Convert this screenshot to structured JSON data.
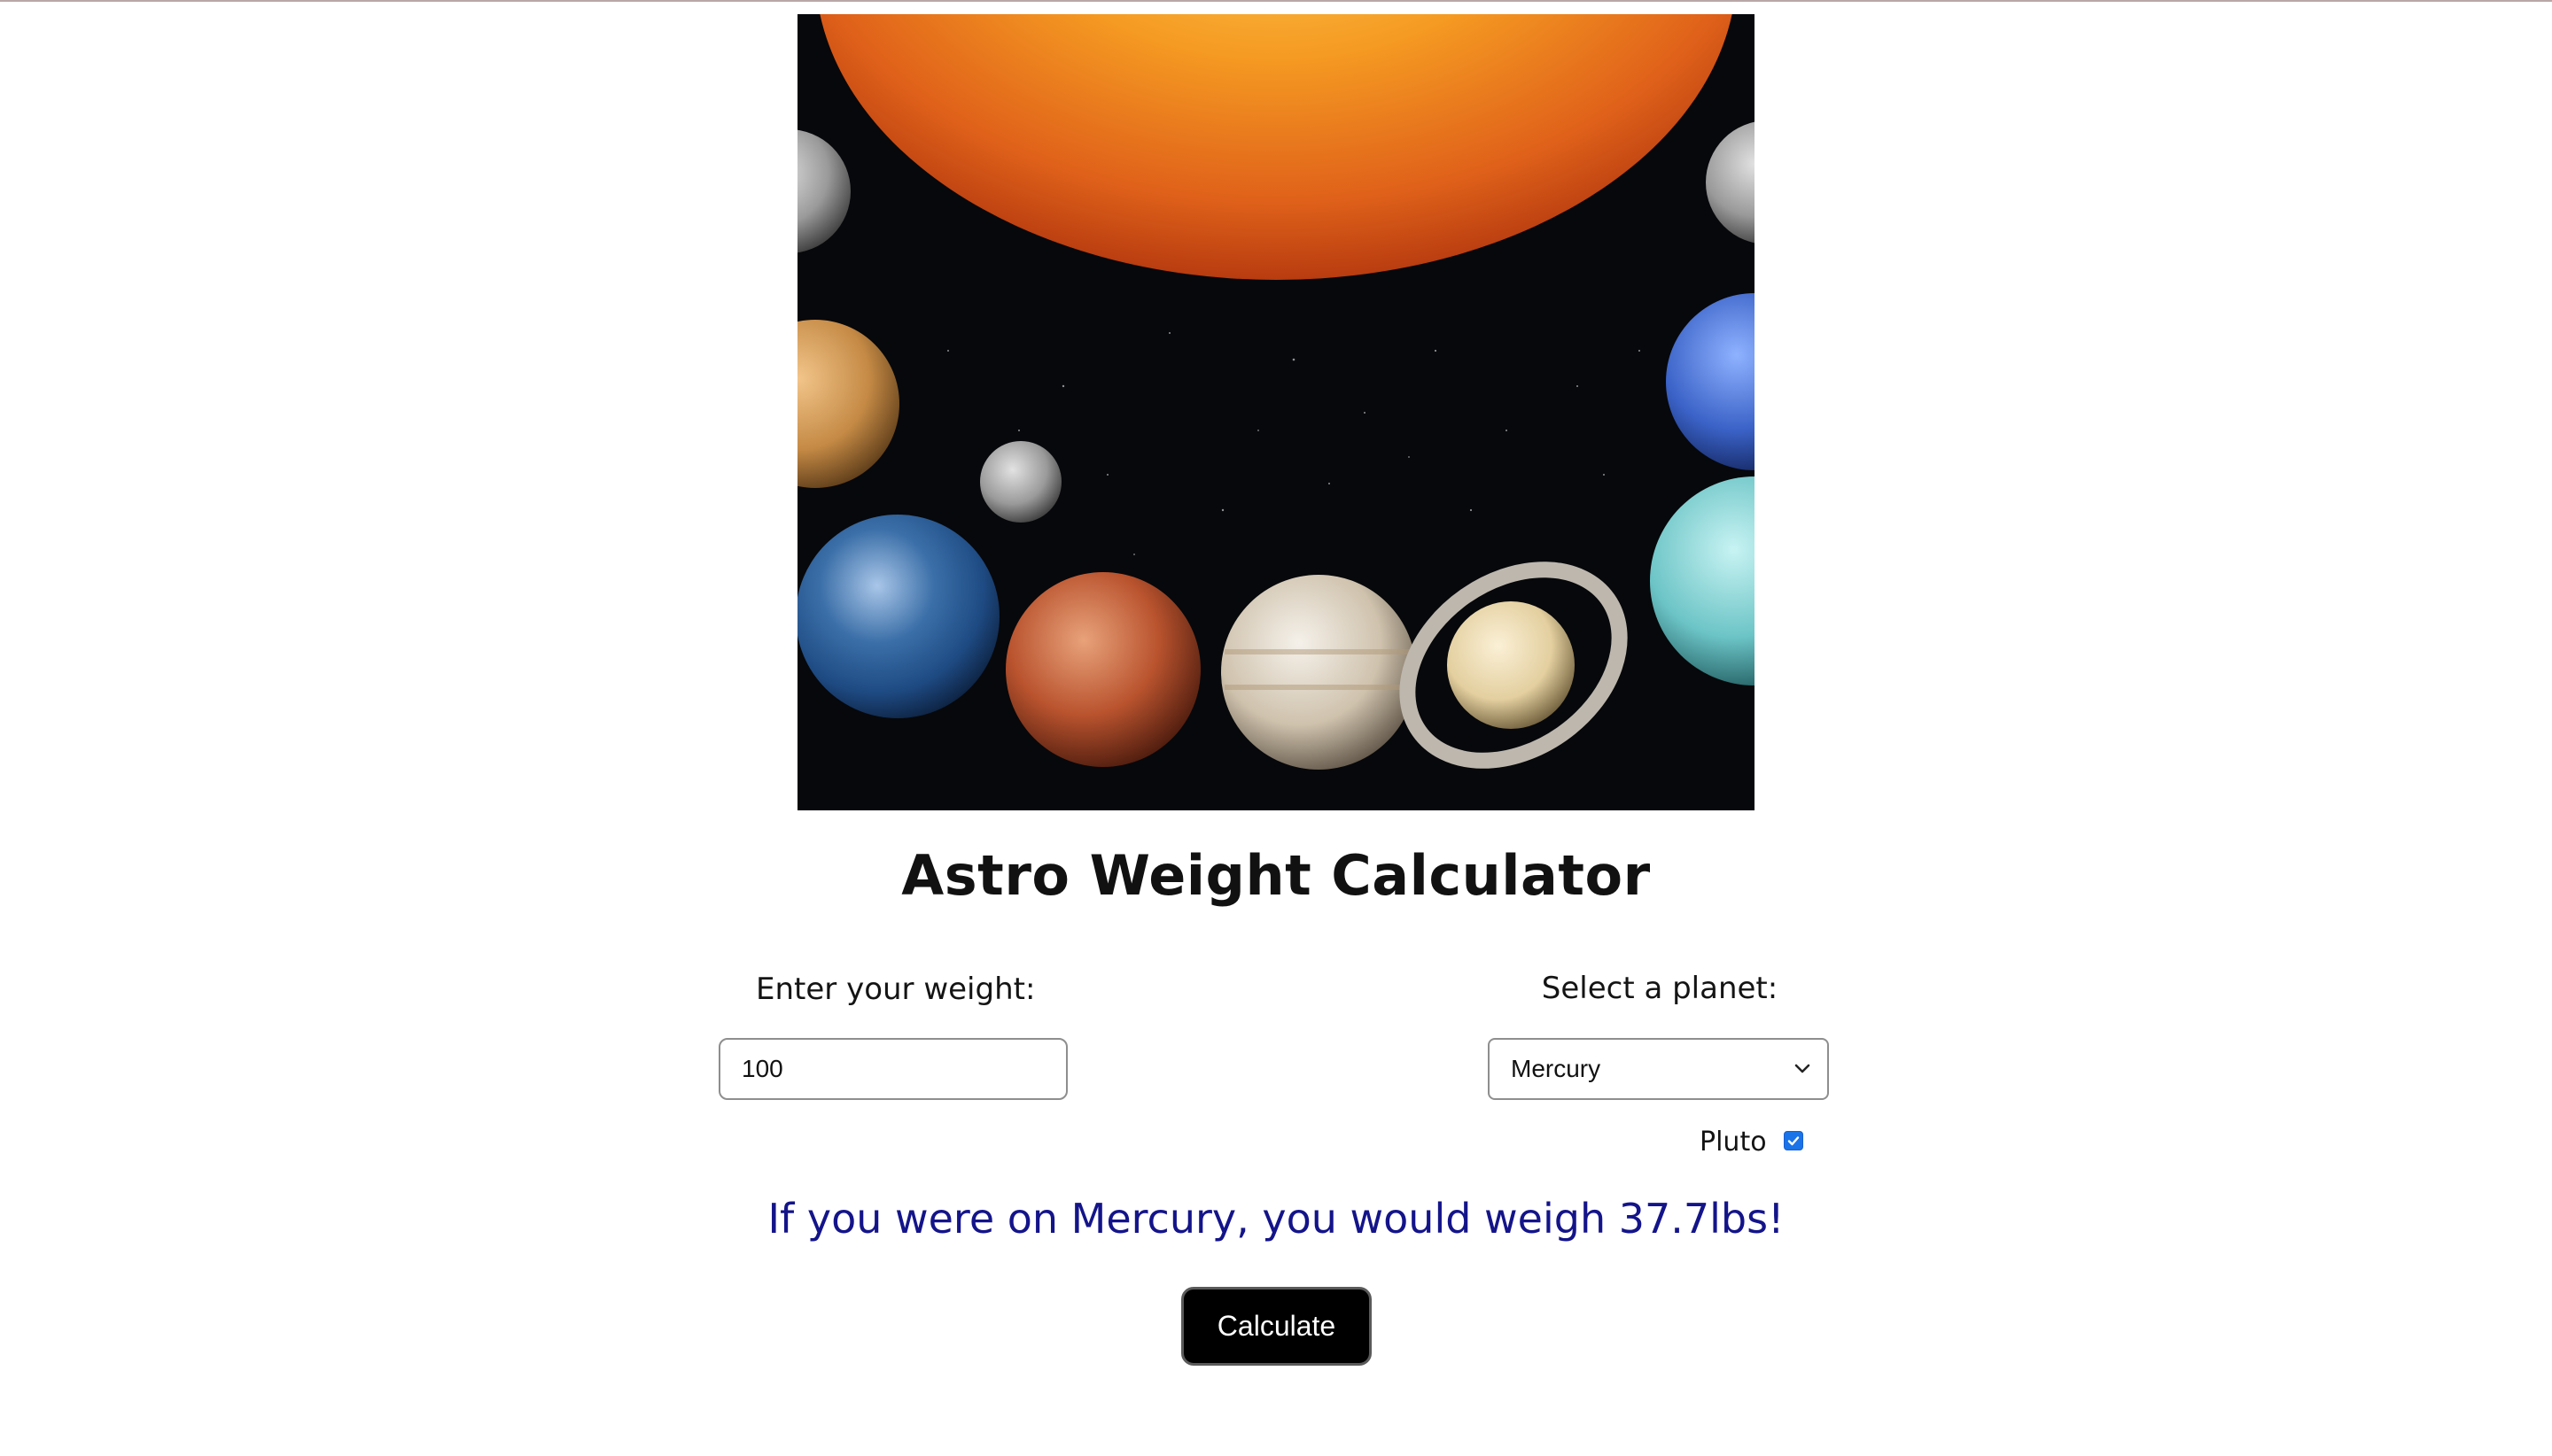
{
  "hero": {
    "image_name": "solar-system-planets-image"
  },
  "page": {
    "title": "Astro Weight Calculator"
  },
  "form": {
    "weight_label": "Enter your weight:",
    "weight_value": "100",
    "planet_label": "Select a planet:",
    "planet_selected": "Mercury",
    "pluto_label": "Pluto",
    "pluto_checked": true,
    "button_label": "Calculate"
  },
  "result": {
    "text": "If you were on Mercury, you would weigh 37.7lbs!"
  },
  "colors": {
    "result_text": "#14148a",
    "button_bg": "#000000",
    "checkbox_accent": "#1a73e8"
  },
  "icons": {
    "select_arrow": "chevron-down-icon",
    "checkbox_mark": "checkmark-icon"
  }
}
